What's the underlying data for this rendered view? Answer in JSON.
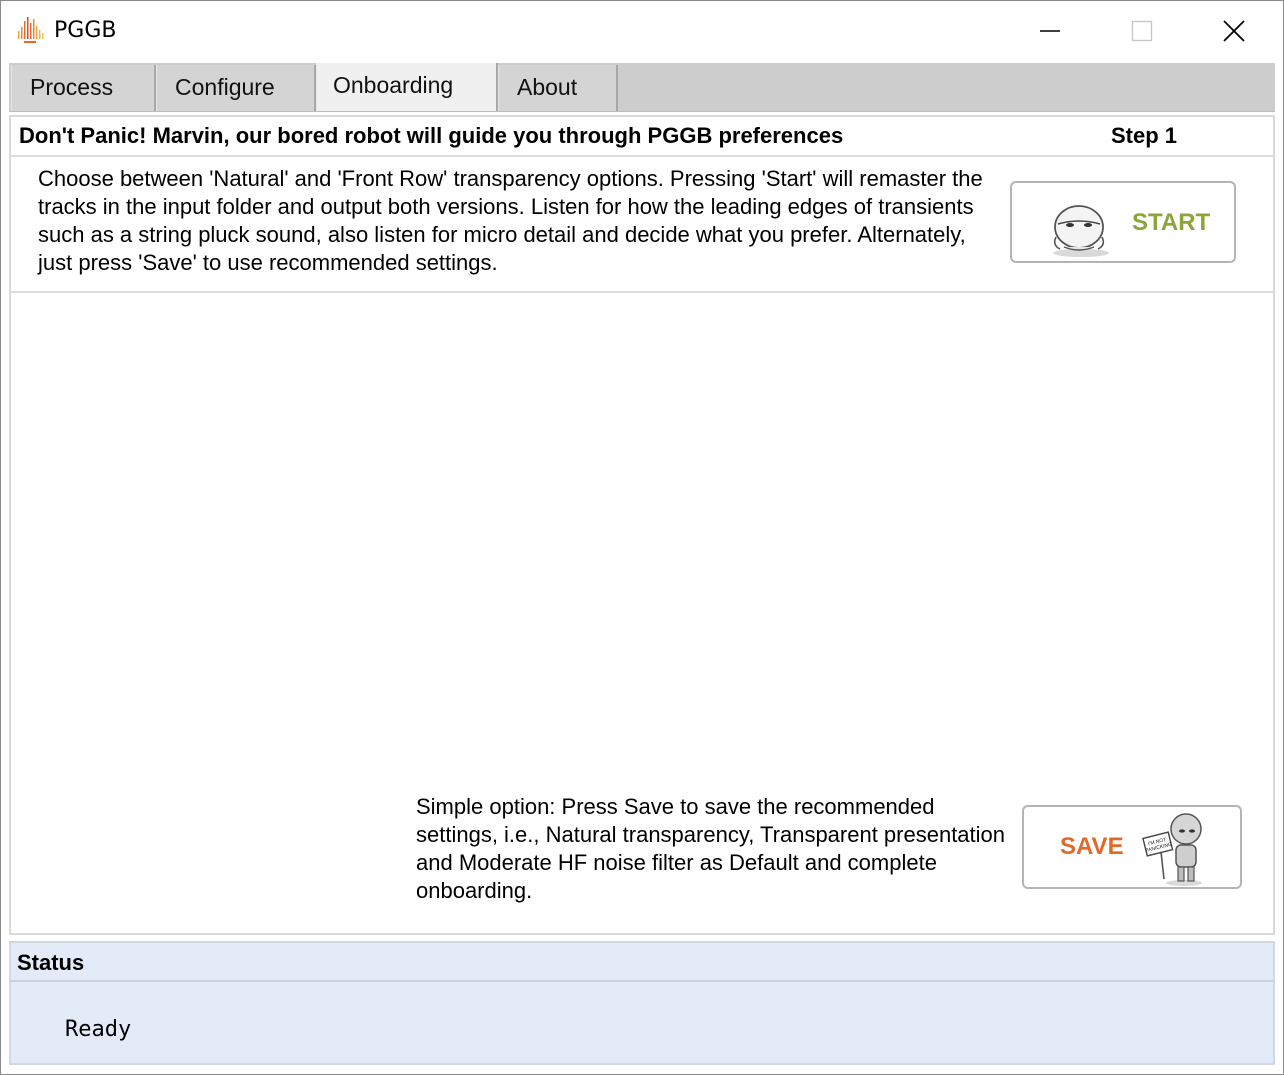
{
  "window": {
    "title": "PGGB"
  },
  "tabs": [
    {
      "label": "Process"
    },
    {
      "label": "Configure"
    },
    {
      "label": "Onboarding"
    },
    {
      "label": "About"
    }
  ],
  "active_tab": "Onboarding",
  "onboarding": {
    "heading": "Don't Panic! Marvin, our bored robot will guide you through PGGB preferences",
    "step": "Step 1",
    "step_description": "Choose between 'Natural' and 'Front Row' transparency options. Pressing 'Start' will remaster the tracks in the input folder and output both versions. Listen for how the leading edges of transients such as a string pluck sound, also listen for micro detail and decide what you prefer. Alternately, just press 'Save' to use recommended settings.",
    "start_label": "START",
    "simple_option": "Simple option: Press Save to save the recommended settings, i.e., Natural transparency, Transparent presentation and Moderate HF noise filter as Default and complete onboarding.",
    "save_label": "SAVE",
    "save_sign_text": "I'M NOT PANICKING"
  },
  "status": {
    "title": "Status",
    "text": "Ready"
  },
  "colors": {
    "start_accent": "#8aa63b",
    "save_accent": "#e06a2c",
    "status_background": "#e3ebf8",
    "tabbar_background": "#cdcdcd"
  },
  "icons": [
    "pggb-logo-icon",
    "minimize-icon",
    "maximize-icon",
    "close-icon",
    "marvin-robot-head-icon",
    "marvin-robot-sign-icon"
  ]
}
